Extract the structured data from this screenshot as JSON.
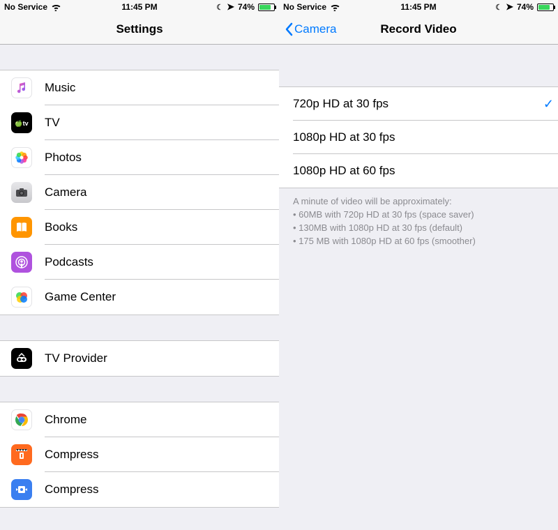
{
  "status": {
    "carrier": "No Service",
    "time": "11:45 PM",
    "battery_pct": "74%"
  },
  "left": {
    "title": "Settings",
    "groups": [
      {
        "items": [
          {
            "key": "music",
            "label": "Music",
            "icon": "music-icon"
          },
          {
            "key": "tv",
            "label": "TV",
            "icon": "tv-icon"
          },
          {
            "key": "photos",
            "label": "Photos",
            "icon": "photos-icon"
          },
          {
            "key": "camera",
            "label": "Camera",
            "icon": "camera-icon"
          },
          {
            "key": "books",
            "label": "Books",
            "icon": "books-icon"
          },
          {
            "key": "podcasts",
            "label": "Podcasts",
            "icon": "podcasts-icon"
          },
          {
            "key": "gc",
            "label": "Game Center",
            "icon": "gamecenter-icon"
          }
        ]
      },
      {
        "items": [
          {
            "key": "tvprovider",
            "label": "TV Provider",
            "icon": "tvprovider-icon"
          }
        ]
      },
      {
        "items": [
          {
            "key": "chrome",
            "label": "Chrome",
            "icon": "chrome-icon"
          },
          {
            "key": "compress1",
            "label": "Compress",
            "icon": "compress1-icon"
          },
          {
            "key": "compress2",
            "label": "Compress",
            "icon": "compress2-icon"
          }
        ]
      }
    ]
  },
  "right": {
    "back_label": "Camera",
    "title": "Record Video",
    "options": [
      {
        "label": "720p HD at 30 fps",
        "selected": true
      },
      {
        "label": "1080p HD at 30 fps",
        "selected": false
      },
      {
        "label": "1080p HD at 60 fps",
        "selected": false
      }
    ],
    "footer_lead": "A minute of video will be approximately:",
    "footer_lines": [
      "60MB with 720p HD at 30 fps (space saver)",
      "130MB with 1080p HD at 30 fps (default)",
      "175 MB with 1080p HD at 60 fps (smoother)"
    ]
  },
  "icons": {
    "music-icon": "ic-music",
    "tv-icon": "ic-tv",
    "photos-icon": "ic-photos",
    "camera-icon": "ic-camera",
    "books-icon": "ic-books",
    "podcasts-icon": "ic-pod",
    "gamecenter-icon": "ic-gc",
    "tvprovider-icon": "ic-tvprov",
    "chrome-icon": "ic-chrome",
    "compress1-icon": "ic-comp1",
    "compress2-icon": "ic-comp2"
  }
}
